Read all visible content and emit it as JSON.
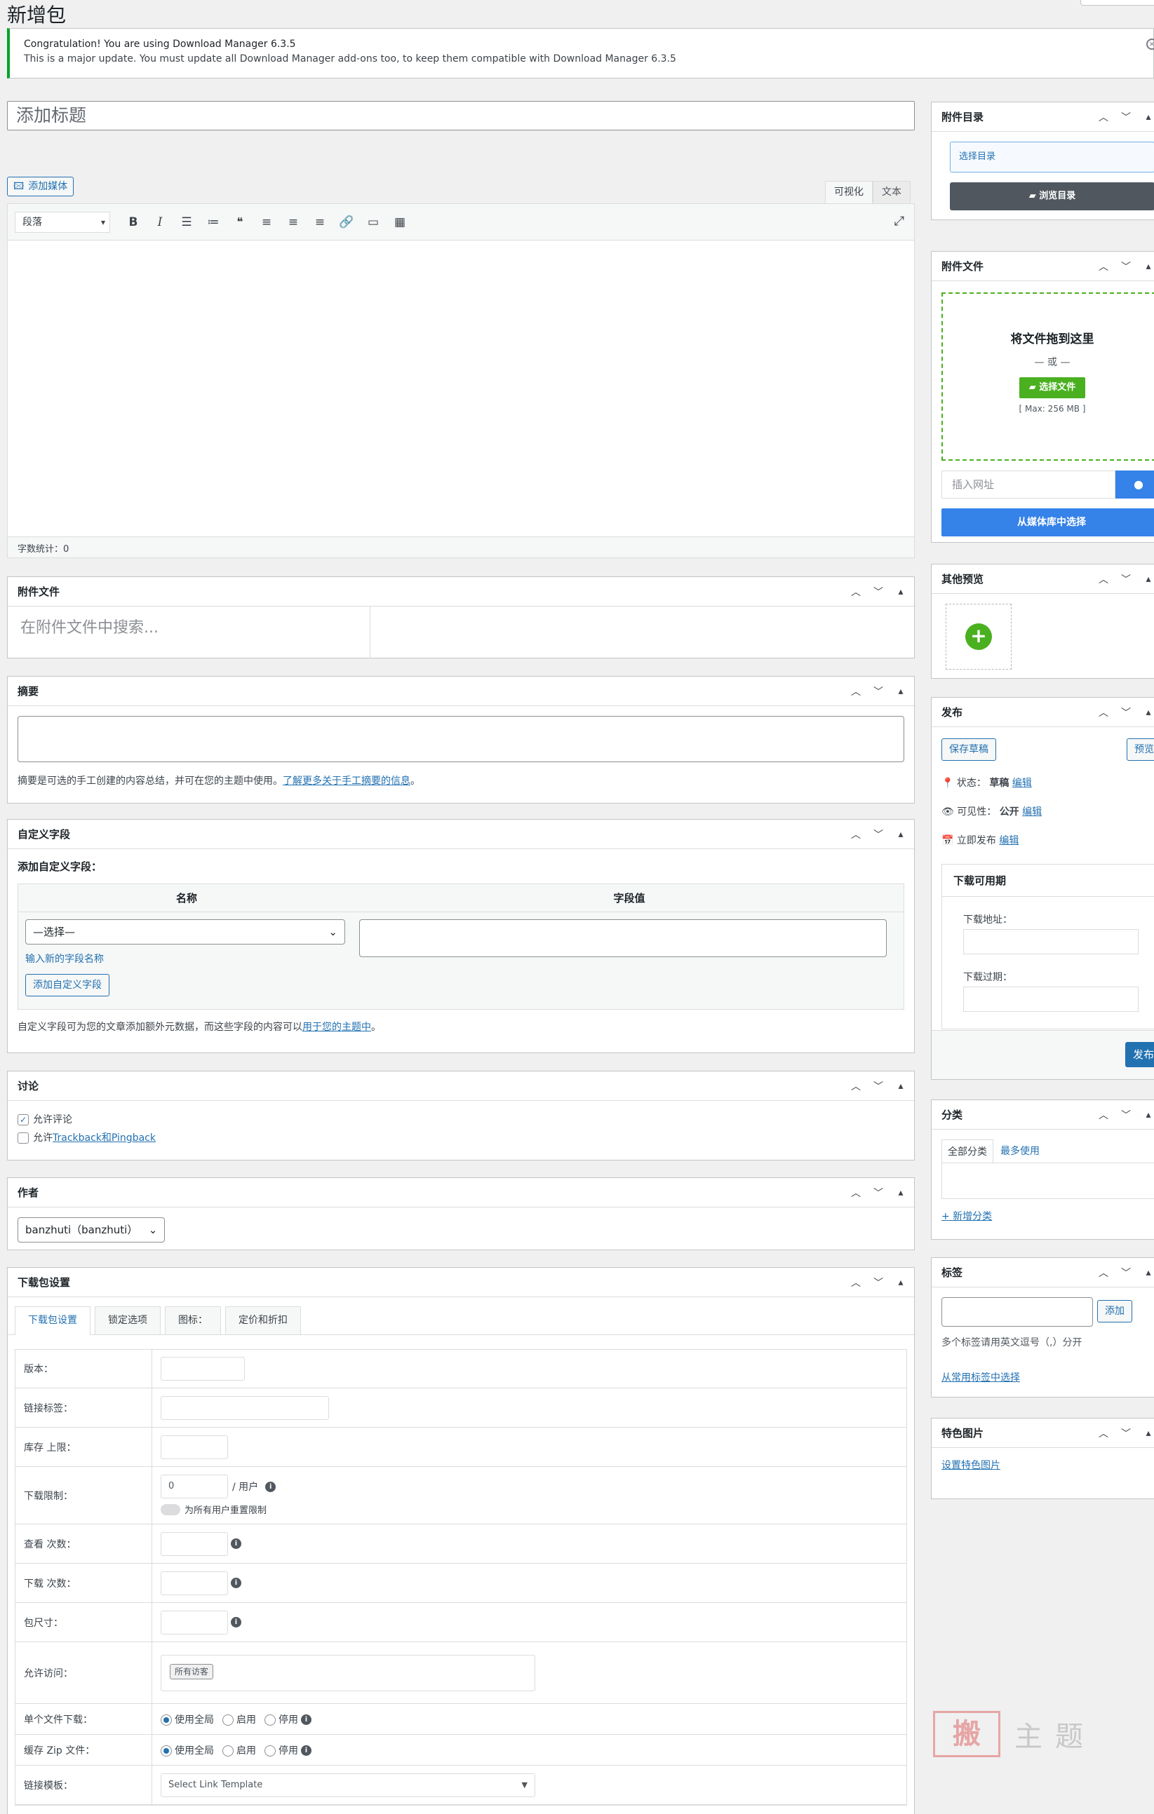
{
  "page": {
    "title": "新增包"
  },
  "notice": {
    "line1": "Congratulation! You are using Download Manager 6.3.5",
    "line2": "This is a major update. You must update all Download Manager add-ons too, to keep them compatible with Download Manager 6.3.5",
    "dismiss": "×"
  },
  "title_field": {
    "placeholder": "添加标题"
  },
  "editor": {
    "add_media": "添加媒体",
    "tab_visual": "可视化",
    "tab_text": "文本",
    "format": "段落",
    "word_count": "字数统计：0"
  },
  "attachments_box": {
    "title": "附件文件",
    "search_placeholder": "在附件文件中搜索..."
  },
  "excerpt_box": {
    "title": "摘要",
    "desc_prefix": "摘要是可选的手工创建的内容总结，并可在您的主题中使用。",
    "desc_link": "了解更多关于手工摘要的信息",
    "desc_suffix": "。"
  },
  "custom_fields": {
    "title": "自定义字段",
    "subtitle": "添加自定义字段：",
    "col_name": "名称",
    "col_value": "字段值",
    "select": "—选择—",
    "enter_new": "输入新的字段名称",
    "add_btn": "添加自定义字段",
    "desc_prefix": "自定义字段可为您的文章添加额外元数据，而这些字段的内容可以",
    "desc_link": "用于您的主题中",
    "desc_suffix": "。"
  },
  "discussion": {
    "title": "讨论",
    "allow_comments": "允许评论",
    "allow_pings_prefix": "允许",
    "allow_pings_link": "Trackback和Pingback"
  },
  "author": {
    "title": "作者",
    "value": "banzhuti（banzhuti）"
  },
  "package_settings": {
    "title": "下载包设置",
    "tabs": [
      "下载包设置",
      "锁定选项",
      "图标：",
      "定价和折扣"
    ],
    "version": "版本：",
    "link_label": "链接标签：",
    "stock_limit": "库存 上限：",
    "download_limit": "下载限制：",
    "download_limit_value": "0",
    "per_user": "/ 用户",
    "reset_limit": "为所有用户重置限制",
    "view_count": "查看 次数：",
    "download_count": "下载 次数：",
    "package_size": "包尺寸：",
    "allow_access": "允许访问：",
    "all_visitors": "所有访客",
    "single_file_dl": "单个文件下载：",
    "cache_zip": "缓存 Zip 文件：",
    "use_global": "使用全局",
    "enable": "启用",
    "disable": "停用",
    "link_template": "链接模板：",
    "link_template_value": "Select Link Template"
  },
  "sidebar": {
    "dir_box": {
      "title": "附件目录",
      "select_placeholder": "选择目录",
      "browse": "浏览目录"
    },
    "files_box": {
      "title": "附件文件",
      "drop": "将文件拖到这里",
      "or": "— 或 —",
      "select_files": "选择文件",
      "max": "[ Max: 256 MB ]",
      "url_placeholder": "插入网址",
      "from_media": "从媒体库中选择"
    },
    "preview_box": {
      "title": "其他预览"
    },
    "publish_box": {
      "title": "发布",
      "save_draft": "保存草稿",
      "preview": "预览",
      "status_label": "状态：",
      "status_value": "草稿",
      "edit": "编辑",
      "visibility_label": "可见性：",
      "visibility_value": "公开",
      "publish_time": "立即发布",
      "availability": "下载可用期",
      "dl_address": "下载地址：",
      "dl_expire": "下载过期：",
      "publish_btn": "发布"
    },
    "category_box": {
      "title": "分类",
      "tab_all": "全部分类",
      "tab_popular": "最多使用",
      "add_new": "+ 新增分类"
    },
    "tags_box": {
      "title": "标签",
      "add": "添加",
      "hint": "多个标签请用英文逗号（,）分开",
      "choose": "从常用标签中选择"
    },
    "featured_box": {
      "title": "特色图片",
      "set": "设置特色图片"
    }
  },
  "watermark": {
    "seal": "搬",
    "text": "主题"
  },
  "colors": {
    "accent": "#2271b1",
    "success": "#00a32a",
    "green_btn": "#4ab020",
    "dark_btn": "#50575e",
    "blue_btn": "#3582e8"
  }
}
